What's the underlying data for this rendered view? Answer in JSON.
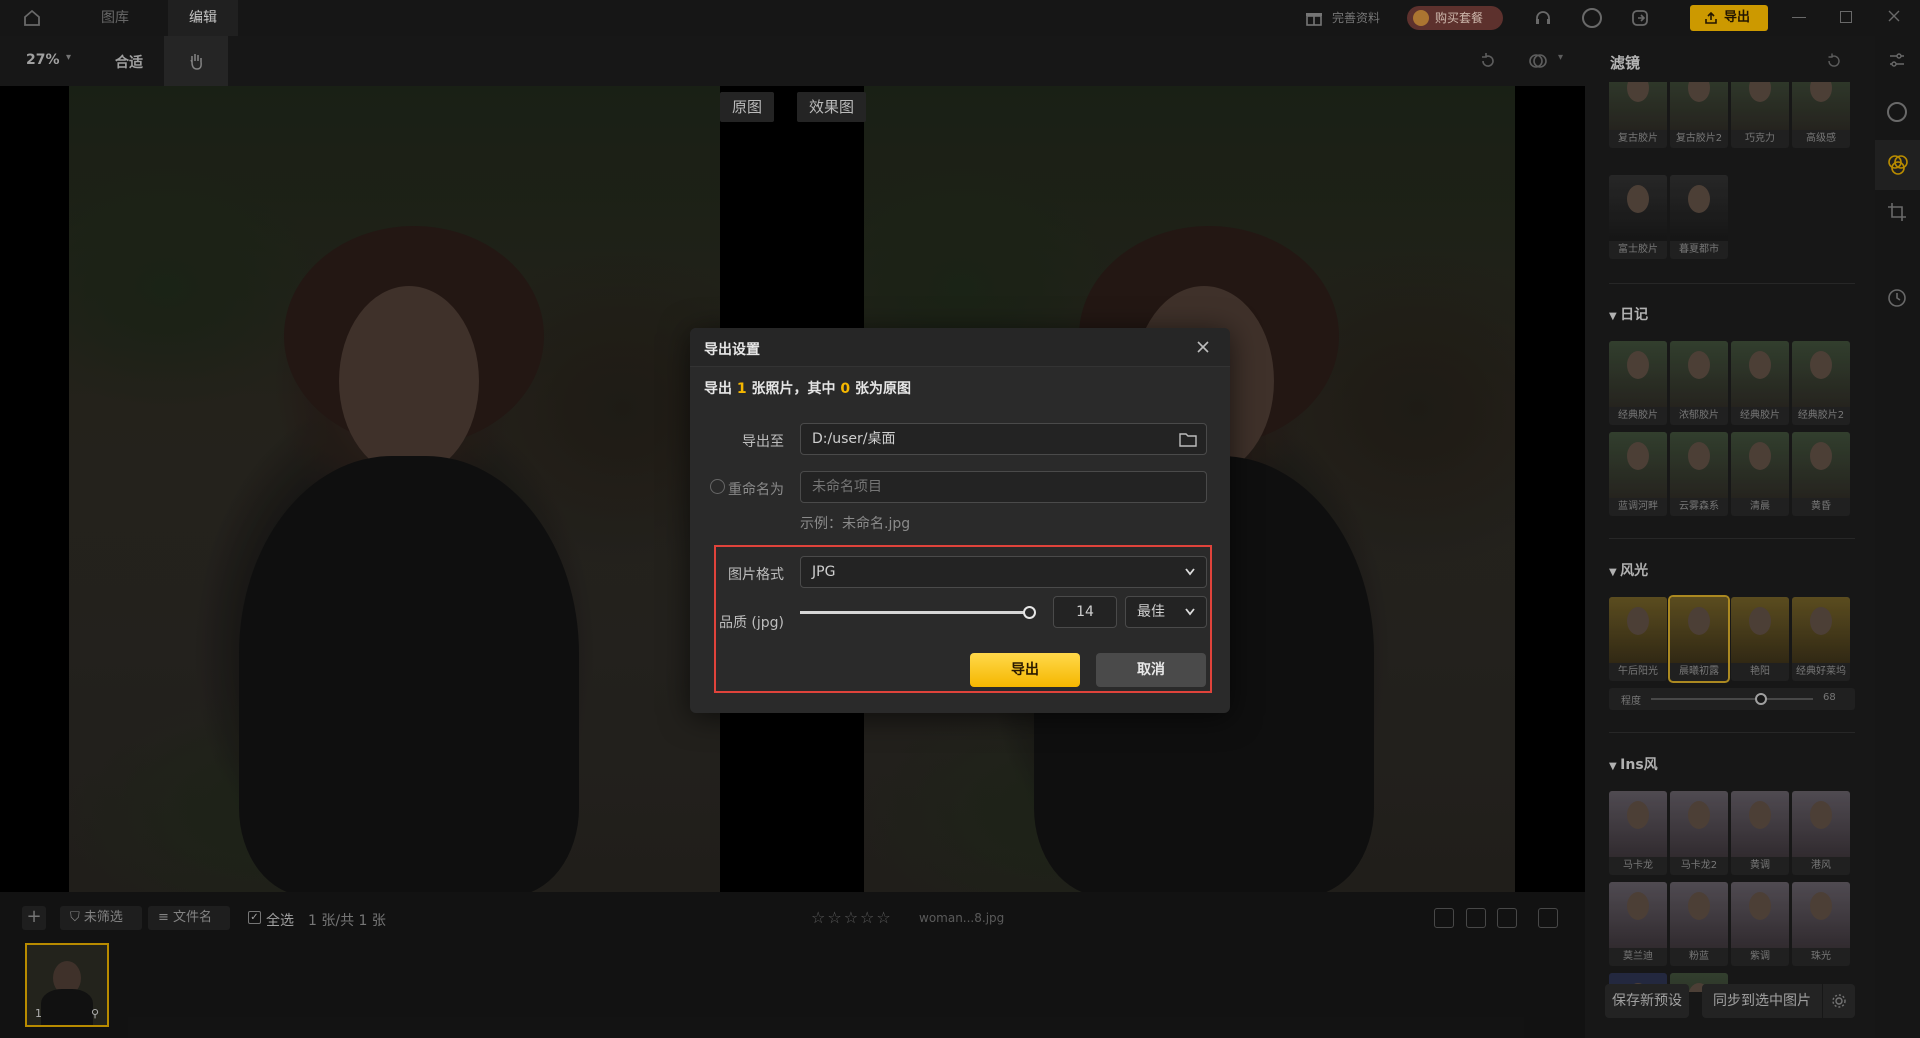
{
  "topbar": {
    "tabs": [
      {
        "label": "图库"
      },
      {
        "label": "编辑"
      }
    ],
    "gift_label": "完善资料",
    "buy_label": "购买套餐",
    "export_label": "导出"
  },
  "toolbar": {
    "zoom": "27%",
    "fit_label": "合适"
  },
  "compare": {
    "original": "原图",
    "effect": "效果图"
  },
  "bottom": {
    "filter_label": "未筛选",
    "sort_label": "文件名",
    "select_all_label": "全选",
    "count_text": "1 张/共 1 张",
    "filename": "woman...8.jpg",
    "thumb_index": "1"
  },
  "panel": {
    "title": "滤镜",
    "top_row_caps": [
      "复古胶片",
      "复古胶片2",
      "巧克力",
      "高级感"
    ],
    "top_row2_caps": [
      "富士胶片",
      "暮夏都市"
    ],
    "sections": [
      {
        "title": "日记",
        "caps": [
          "经典胶片",
          "浓郁胶片",
          "经典胶片",
          "经典胶片2",
          "蓝调河畔",
          "云雾森系",
          "清晨",
          "黄昏"
        ]
      },
      {
        "title": "风光",
        "caps": [
          "午后阳光",
          "晨曦初露",
          "艳阳",
          "经典好莱坞"
        ]
      },
      {
        "title": "Ins风",
        "caps": [
          "马卡龙",
          "马卡龙2",
          "黄调",
          "港风",
          "莫兰迪",
          "粉蓝",
          "紫调",
          "珠光"
        ]
      }
    ],
    "intensity_label": "程度",
    "intensity_value": "68",
    "intensity_level": 0.68,
    "save_preset_label": "保存新预设",
    "sync_label": "同步到选中图片"
  },
  "dialog": {
    "title": "导出设置",
    "summary_pre": "导出 ",
    "summary_count": "1",
    "summary_mid": " 张照片，其中 ",
    "summary_orig": "0",
    "summary_post": " 张为原图",
    "export_to_label": "导出至",
    "export_path": "D:/user/桌面",
    "rename_label": "重命名为",
    "rename_placeholder": "未命名项目",
    "example_text": "示例：未命名.jpg",
    "format_label": "图片格式",
    "format_value": "JPG",
    "quality_label": "品质 (jpg)",
    "quality_value": "14",
    "quality_level": 1.0,
    "quality_preset": "最佳",
    "export_button": "导出",
    "cancel_button": "取消"
  },
  "colors": {
    "accent": "#f5b700",
    "highlight_border": "#e0433b"
  }
}
